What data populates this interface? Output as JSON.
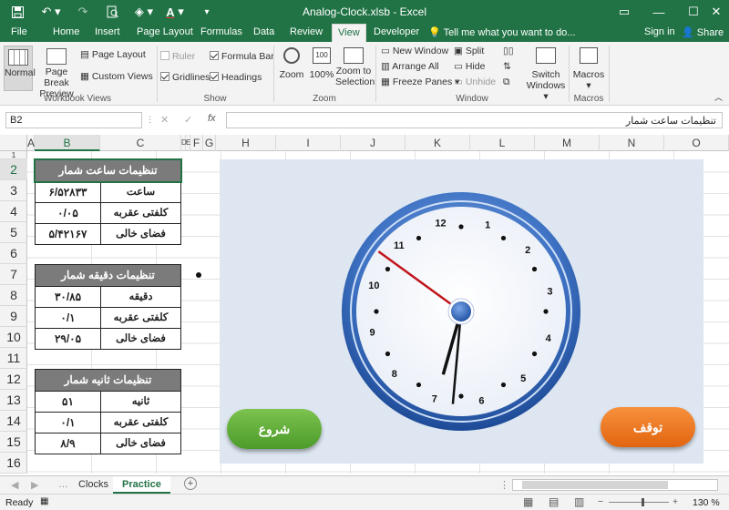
{
  "window": {
    "title": "Analog-Clock.xlsb - Excel",
    "signin": "Sign in",
    "share": "Share"
  },
  "tabs": [
    "File",
    "Home",
    "Insert",
    "Page Layout",
    "Formulas",
    "Data",
    "Review",
    "View",
    "Developer"
  ],
  "active_tab": "View",
  "tell_me": "Tell me what you want to do...",
  "ribbon": {
    "workbook_views": {
      "label": "Workbook Views",
      "normal": "Normal",
      "page_break": "Page Break Preview",
      "page_layout": "Page Layout",
      "custom_views": "Custom Views"
    },
    "show": {
      "label": "Show",
      "ruler": "Ruler",
      "gridlines": "Gridlines",
      "formula_bar": "Formula Bar",
      "headings": "Headings"
    },
    "zoom": {
      "label": "Zoom",
      "zoom": "Zoom",
      "hundred": "100%",
      "zoom_selection": "Zoom to Selection"
    },
    "window": {
      "label": "Window",
      "new_window": "New Window",
      "arrange_all": "Arrange All",
      "freeze_panes": "Freeze Panes",
      "split": "Split",
      "hide": "Hide",
      "unhide": "Unhide",
      "switch_windows": "Switch Windows"
    },
    "macros": {
      "label": "Macros",
      "macros": "Macros"
    }
  },
  "formula_bar": {
    "name_box": "B2",
    "fx": "fx",
    "content": "تنظیمات ساعت شمار"
  },
  "columns": [
    "A",
    "B",
    "C",
    "D",
    "E",
    "F",
    "G",
    "H",
    "I",
    "J",
    "K",
    "L",
    "M",
    "N",
    "O"
  ],
  "rows": [
    "1",
    "2",
    "3",
    "4",
    "5",
    "6",
    "7",
    "8",
    "9",
    "10",
    "11",
    "12",
    "13",
    "14",
    "15",
    "16"
  ],
  "tables": [
    {
      "title": "تنظیمات ساعت شمار",
      "rows": [
        {
          "value": "۶/۵۲۸۳۳",
          "key": "ساعت"
        },
        {
          "value": "۰/۰۵",
          "key": "کلفتی عقربه"
        },
        {
          "value": "۵/۴۲۱۶۷",
          "key": "فضای خالی"
        }
      ]
    },
    {
      "title": "تنظیمات دقیقه شمار",
      "rows": [
        {
          "value": "۳۰/۸۵",
          "key": "دقیقه"
        },
        {
          "value": "۰/۱",
          "key": "کلفتی عقربه"
        },
        {
          "value": "۲۹/۰۵",
          "key": "فضای خالی"
        }
      ]
    },
    {
      "title": "تنظیمات ثانیه شمار",
      "rows": [
        {
          "value": "۵۱",
          "key": "ثانیه"
        },
        {
          "value": "۰/۱",
          "key": "کلفتی عقربه"
        },
        {
          "value": "۸/۹",
          "key": "فضای خالی"
        }
      ]
    }
  ],
  "clock": {
    "numbers": [
      "1",
      "2",
      "3",
      "4",
      "5",
      "6",
      "7",
      "8",
      "9",
      "10",
      "11",
      "12"
    ],
    "hour": 6.52833,
    "minute": 30.85,
    "second": 51,
    "second_hand_color": "#c0141b",
    "ring_color": "#3f73c4"
  },
  "buttons": {
    "start": "شروع",
    "stop": "توقف"
  },
  "sheets": [
    "Clocks",
    "Practice"
  ],
  "active_sheet": "Practice",
  "status": {
    "ready": "Ready",
    "zoom": "130 %"
  }
}
